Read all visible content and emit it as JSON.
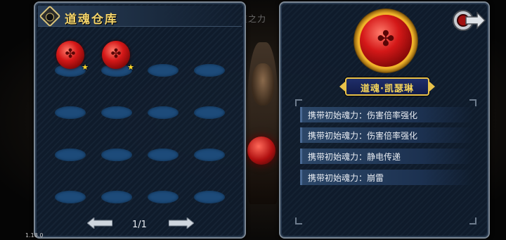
{
  "warehouse": {
    "title": "道魂仓库",
    "slots_per_row": 4,
    "rows": 4,
    "items": [
      {
        "slot": 0,
        "type": "red-soul-orb",
        "starred": true
      },
      {
        "slot": 1,
        "type": "red-soul-orb",
        "starred": true
      }
    ],
    "pagination": {
      "text": "1/1"
    }
  },
  "background": {
    "title_fragment": "道之力"
  },
  "detail": {
    "name": "道魂·凯瑟琳",
    "attributes": [
      "携带初始魂力：伤害倍率强化",
      "携带初始魂力：伤害倍率强化",
      "携带初始魂力：静电传递",
      "携带初始魂力：崩雷"
    ]
  },
  "version": "1.18.0",
  "colors": {
    "panel_bg": "#121e30",
    "title_gold": "#f3d36a",
    "slot_blue": "#1d4b7a",
    "orb_red": "#d41818"
  }
}
